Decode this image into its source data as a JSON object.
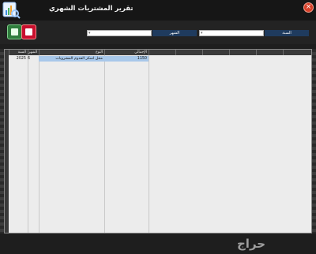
{
  "window": {
    "title": "تقرير المشتريات الشهري",
    "close_glyph": "×"
  },
  "toolbar": {
    "year_label": "السنة",
    "month_label": "الشهر",
    "year_value": "",
    "month_value": ""
  },
  "grid": {
    "columns": [
      "الإجمالي",
      "النوع",
      "الشهر",
      "السنة"
    ],
    "rows": [
      {
        "total": "1150",
        "type": "محل اسكر الفدوم المشروبات",
        "month": "6",
        "year": "2025"
      }
    ]
  },
  "watermark": "حراج",
  "colors": {
    "titlebar_bg": "#161616",
    "label_bg": "#1f3b5e",
    "selected_cell": "#a8c8ea",
    "close_red": "#d8412a"
  },
  "icons": [
    "report-app-icon",
    "close-icon",
    "excel-export-icon",
    "pdf-export-icon",
    "dropdown-arrow-icon"
  ]
}
